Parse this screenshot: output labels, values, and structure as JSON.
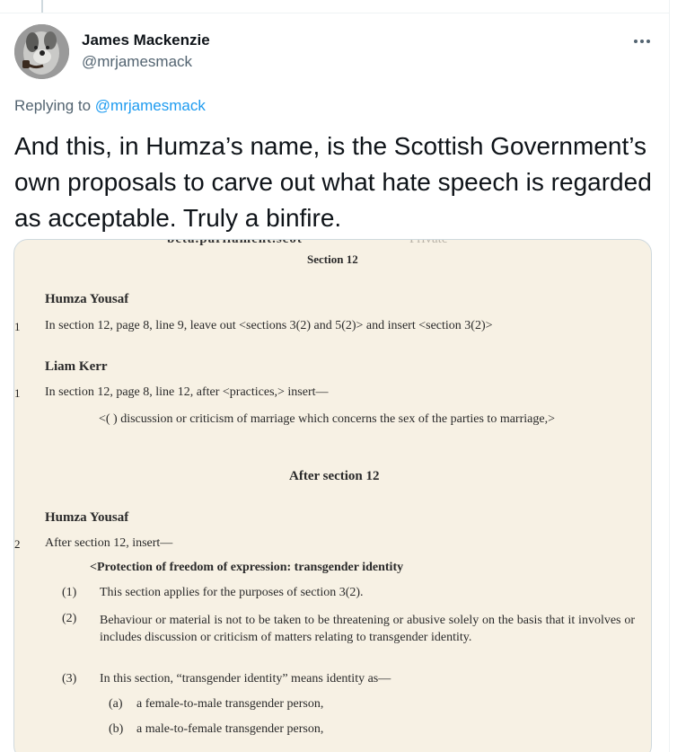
{
  "author": {
    "name": "James Mackenzie",
    "handle": "@mrjamesmack"
  },
  "more_icon": "more-horizontal-icon",
  "reply": {
    "prefix": "Replying to ",
    "handle": "@mrjamesmack"
  },
  "tweet_text": "And this, in Humza’s name, is the Scottish Government’s own proposals to carve out what hate speech is regarded as acceptable. Truly a binfire.",
  "media": {
    "url_fragment": "beta.parliament.scot",
    "url_status": "Private",
    "section_heading": "Section 12",
    "amendments": [
      {
        "member": "Humza Yousaf",
        "number": "1",
        "text": "In section 12, page 8, line 9, leave out <sections 3(2) and 5(2)> and insert <section 3(2)>"
      },
      {
        "member": "Liam Kerr",
        "number": "1",
        "text": "In section 12, page 8, line 12, after <practices,> insert—",
        "insert": "<( )  discussion or criticism of marriage which concerns the sex of the parties to marriage,>"
      }
    ],
    "after_heading": "After section 12",
    "amendment3": {
      "member": "Humza Yousaf",
      "number": "2",
      "text": "After section 12, insert—",
      "title": "<Protection of freedom of expression: transgender identity",
      "items": [
        {
          "num": "(1)",
          "text": "This section applies for the purposes of section 3(2)."
        },
        {
          "num": "(2)",
          "text": "Behaviour or material is not to be taken to be threatening or abusive solely on the basis that it involves or includes discussion or criticism of matters relating to transgender identity."
        },
        {
          "num": "(3)",
          "text": "In this section, “transgender identity” means identity as—"
        }
      ],
      "subitems": [
        {
          "num": "(a)",
          "text": "a female-to-male transgender person,"
        },
        {
          "num": "(b)",
          "text": "a male-to-female transgender person,"
        }
      ]
    }
  }
}
